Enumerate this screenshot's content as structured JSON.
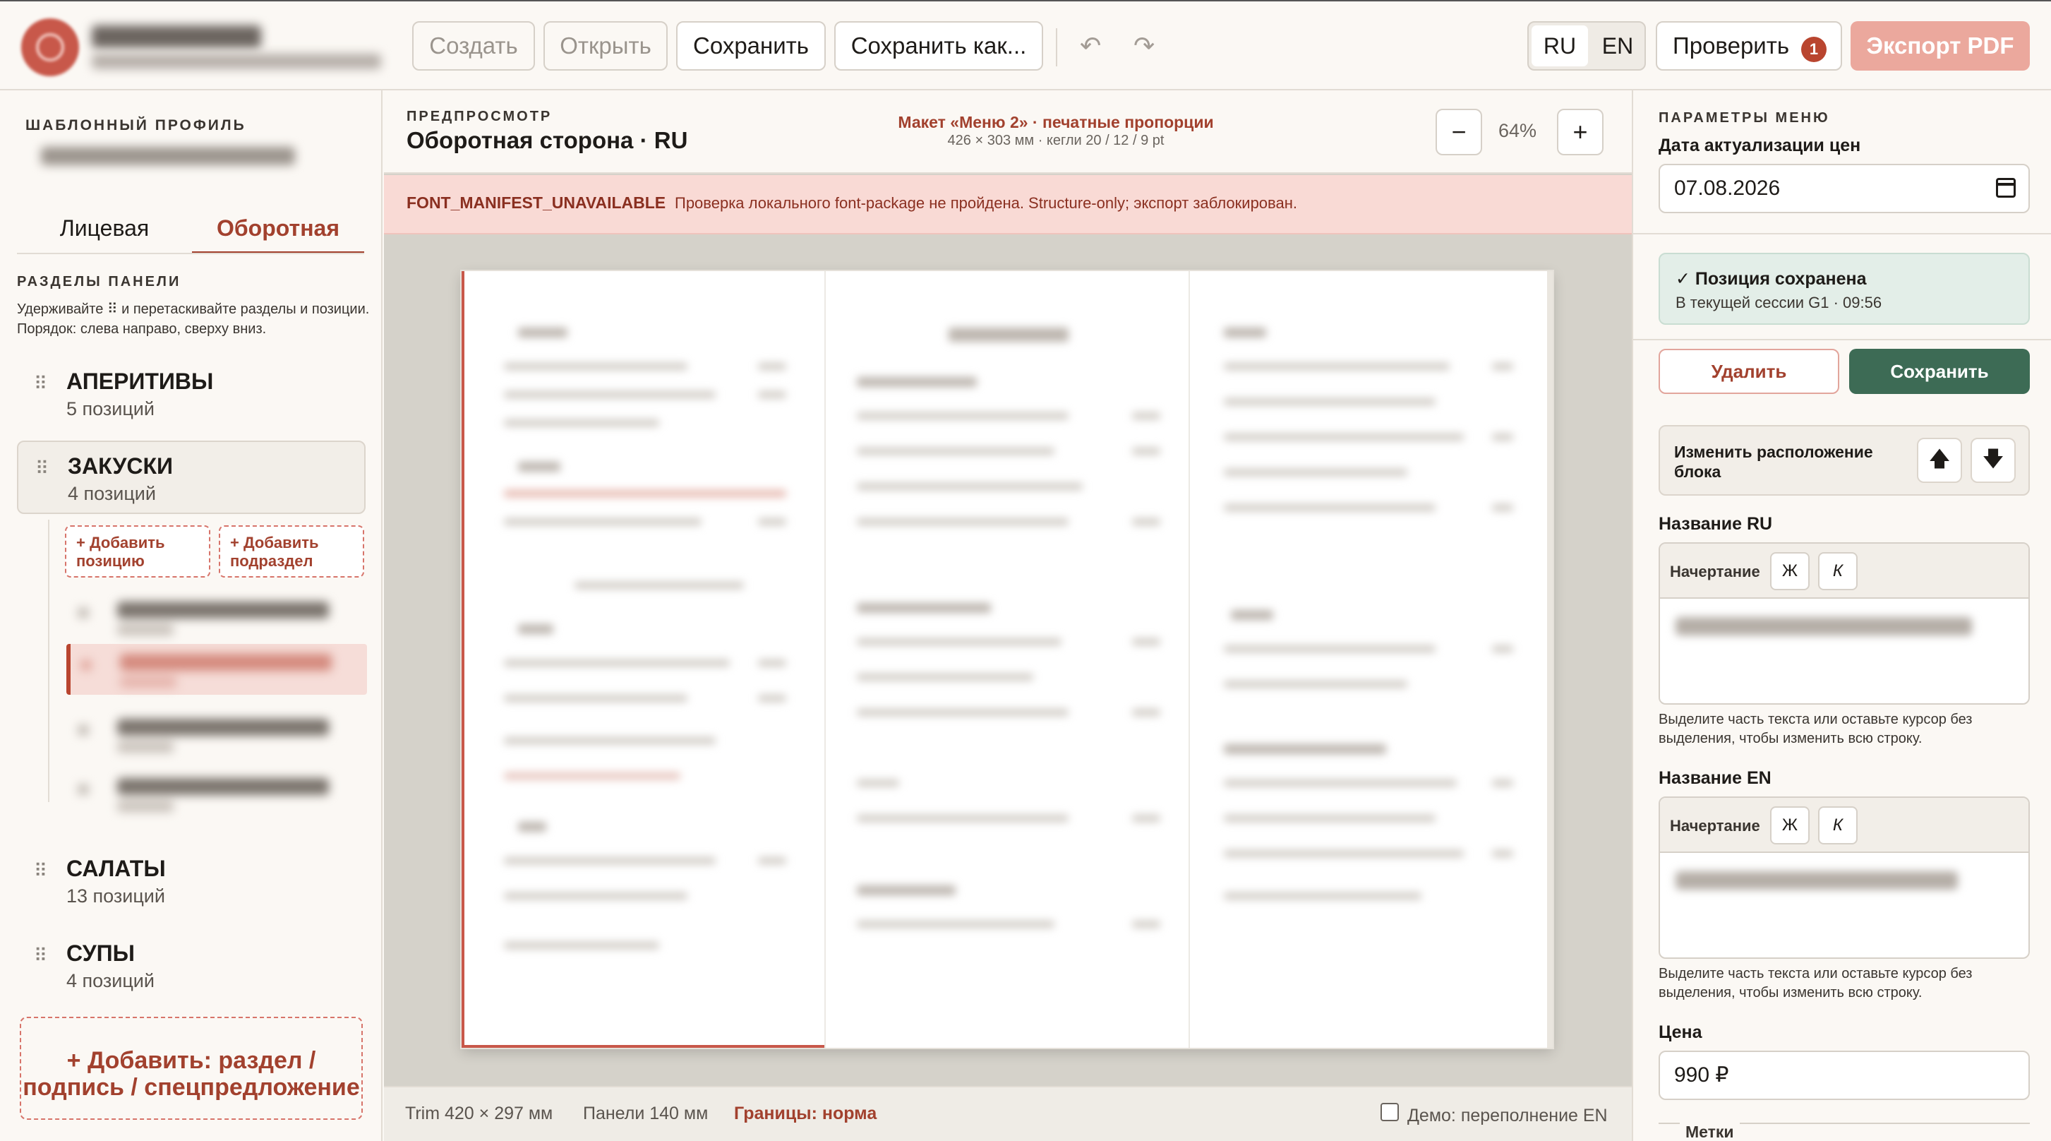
{
  "toolbar": {
    "create": "Создать",
    "open": "Открыть",
    "save": "Сохранить",
    "save_as": "Сохранить как...",
    "undo_icon": "undo-icon",
    "redo_icon": "redo-icon"
  },
  "lang": {
    "ru": "RU",
    "en": "EN"
  },
  "check": {
    "label": "Проверить",
    "count": "1"
  },
  "export_label": "Экспорт PDF",
  "sidebar": {
    "profile_caption": "ШАБЛОННЫЙ ПРОФИЛЬ",
    "tabs": [
      "Лицевая",
      "Оборотная"
    ],
    "sections_caption": "РАЗДЕЛЫ ПАНЕЛИ",
    "hint": "Удерживайте ⠿ и перетаскивайте разделы и позиции. Порядок: слева направо, сверху вниз.",
    "sections": [
      {
        "name": "АПЕРИТИВЫ",
        "count": "5 позиций"
      },
      {
        "name": "ЗАКУСКИ",
        "count": "4 позиций"
      },
      {
        "name": "САЛАТЫ",
        "count": "13 позиций"
      },
      {
        "name": "СУПЫ",
        "count": "4 позиций"
      }
    ],
    "add_item": "+ Добавить позицию",
    "add_subsection": "+ Добавить подраздел",
    "add_block": "+ Добавить: раздел / подпись / спецпредложение"
  },
  "preview": {
    "caption": "ПРЕДПРОСМОТР",
    "title": "Оборотная сторона · RU",
    "layout_title": "Макет «Меню 2» · печатные пропорции",
    "layout_sub": "426 × 303 мм · кегли 20 / 12 / 9 pt",
    "zoom": "64%",
    "zoom_out": "−",
    "zoom_in": "+",
    "error_code": "FONT_MANIFEST_UNAVAILABLE",
    "error_msg": "Проверка локального font-package не пройдена. Structure-only; экспорт заблокирован.",
    "trim": "Trim 420 × 297 мм",
    "panels": "Панели 140 мм",
    "bounds": "Границы: норма",
    "demo": "Демо: переполнение EN"
  },
  "params": {
    "caption": "ПАРАМЕТРЫ МЕНЮ",
    "date_label": "Дата актуализации цен",
    "date_value": "07.08.2026",
    "saved_title": "✓ Позиция сохранена",
    "saved_sub": "В текущей сессии G1 · 09:56",
    "delete": "Удалить",
    "save": "Сохранить",
    "move_label": "Изменить расположение блока",
    "up": "🡅",
    "down": "🡇",
    "name_ru_label": "Название RU",
    "name_en_label": "Название EN",
    "style_label": "Начертание",
    "bold": "Ж",
    "italic": "К",
    "note": "Выделите часть текста или оставьте курсор без выделения, чтобы изменить всю строку.",
    "price_label": "Цена",
    "price_value": "990 ₽",
    "tags_label": "Метки"
  }
}
